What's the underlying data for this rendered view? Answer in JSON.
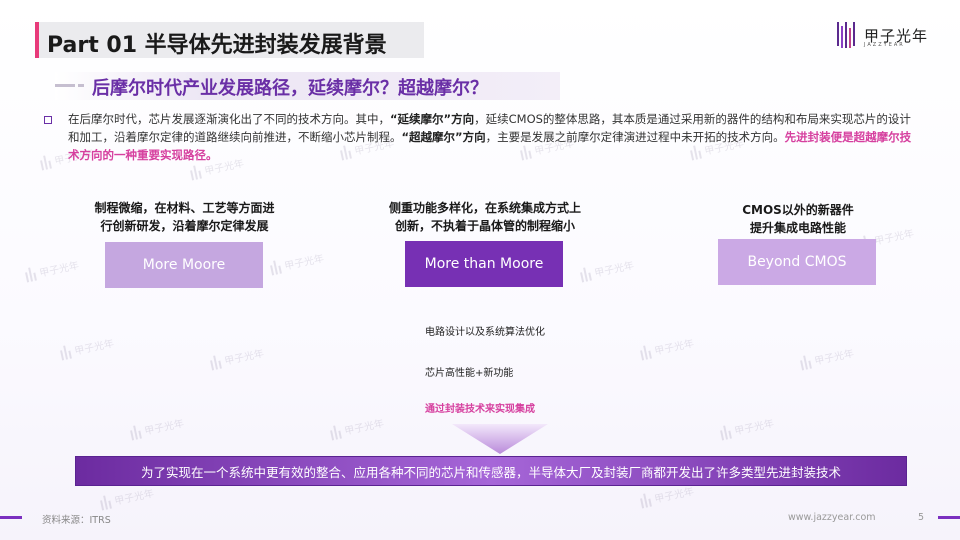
{
  "header": {
    "title": "Part 01 半导体先进封装发展背景",
    "logo_text": "甲子光年",
    "logo_sub": "JAZZYEAR"
  },
  "subtitle": "后摩尔时代产业发展路径，延续摩尔？超越摩尔？",
  "paragraph": {
    "p1": "在后摩尔时代，芯片发展逐渐演化出了不同的技术方向。其中，",
    "b1": "“延续摩尔”方向",
    "p2": "，延续CMOS的整体思路，其本质是通过采用新的器件的结构和布局来实现芯片的设计和加工，沿着摩尔定律的道路继续向前推进，不断缩小芯片制程。",
    "b2": "“超越摩尔”方向",
    "p3": "，主要是发展之前摩尔定律演进过程中未开拓的技术方向。",
    "highlight": "先进封装便是超越摩尔技术方向的一种重要实现路径。"
  },
  "columns": [
    {
      "desc_line1": "制程微缩，在材料、工艺等方面进",
      "desc_line2": "行创新研发，沿着摩尔定律发展",
      "box_label": "More Moore"
    },
    {
      "desc_line1": "侧重功能多样化，在系统集成方式上",
      "desc_line2": "创新，不执着于晶体管的制程缩小",
      "box_label": "More than Moore"
    },
    {
      "desc_line1": "CMOS以外的新器件",
      "desc_line2": "提升集成电路性能",
      "box_label": "Beyond CMOS"
    }
  ],
  "notes": {
    "n1": "电路设计以及系统算法优化",
    "n2": "芯片高性能+新功能",
    "n3": "通过封装技术来实现集成"
  },
  "banner": "为了实现在一个系统中更有效的整合、应用各种不同的芯片和传感器，半导体大厂及封装厂商都开发出了许多类型先进封装技术",
  "footer": {
    "source": "资料来源：ITRS",
    "url": "www.jazzyear.com",
    "page": "5"
  },
  "colors": {
    "accent_purple": "#6a2fa6",
    "highlight_pink": "#d6409f",
    "box_light": "#c5a7e0",
    "box_dark": "#7730b4"
  }
}
